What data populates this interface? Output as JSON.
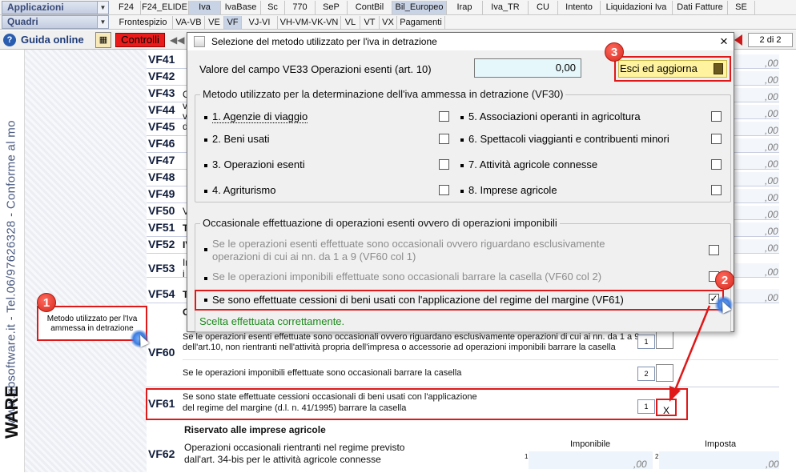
{
  "menu": {
    "applicazioni": "Applicazioni",
    "quadri": "Quadri",
    "tabs_row1": [
      "F24",
      "F24_ELIDE",
      "Iva",
      "IvaBase",
      "Sc",
      "770",
      "SeP",
      "ContBil",
      "Bil_Europeo",
      "Irap",
      "Iva_TR",
      "CU",
      "Intento",
      "Liquidazioni Iva",
      "Dati Fatture",
      "SE"
    ],
    "tabs_row2": [
      "Frontespizio",
      "VA-VB",
      "VE",
      "VF",
      "VJ-VI",
      "VH-VM-VK-VN",
      "VL",
      "VT",
      "VX",
      "Pagamenti"
    ]
  },
  "toolbar": {
    "guida": "Guida online",
    "controlli": "Controlli",
    "page": "2 di 2"
  },
  "side_text": "www.gbsoftware.it - Tel.06/97626328 - Conforme al mo",
  "side_logo": "WARE",
  "form": {
    "rows": [
      "VF41",
      "VF42",
      "VF43",
      "VF44",
      "VF45",
      "VF46",
      "VF47",
      "VF48",
      "VF49",
      "VF50",
      "VF51",
      "VF52",
      "VF53",
      "VF54"
    ],
    "zero": ",00",
    "frag_o": "O",
    "frag_v": "v",
    "frag_d": "d",
    "frag_vo": "Vo",
    "frag_to": "TO",
    "frag_iv": "IV",
    "frag_im": "Im",
    "frag_i": "i",
    "vf60_code": "VF60",
    "vf60_line1": "Se le operazioni esenti effettuate sono occasionali ovvero riguardano esclusivamente operazioni  di cui ai nn. da 1 a 9",
    "vf60_line2": "dell'art.10, non rientranti nell'attività propria dell'impresa o accessorie ad operazioni imponibili barrare la casella",
    "vf60_line3": "Se le operazioni imponibili effettuate sono occasionali barrare la casella",
    "vf60_n1": "1",
    "vf60_n2": "2",
    "vf61_code": "VF61",
    "vf61_line1": "Se sono state effettuate cessioni occasionali di beni usati con l'applicazione",
    "vf61_line2": "del regime del margine (d.l. n. 41/1995) barrare la casella",
    "vf61_n1": "1",
    "vf61_value": "X",
    "riservato": "Riservato alle imprese agricole",
    "vf62_code": "VF62",
    "vf62_line1": "Operazioni occasionali rientranti nel regime previsto",
    "vf62_line2": "dall'art. 34-bis per le attività agricole connesse",
    "imponibile": "Imponibile",
    "imposta": "Imposta",
    "col1": "1",
    "col2": "2",
    "tooltip": "Metodo utilizzato per l'Iva ammessa in detrazione"
  },
  "dialog": {
    "title": "Selezione del metodo utilizzato per l'iva in detrazione",
    "close": "×",
    "ve33_label": "Valore del campo VE33 Operazioni esenti (art. 10)",
    "ve33_value": "0,00",
    "esci_label": "Esci ed aggiorna",
    "group1": "Metodo utilizzato per la determinazione dell'iva ammessa in detrazione (VF30)",
    "opts_left": [
      "1. Agenzie di viaggio",
      "2. Beni usati",
      "3. Operazioni esenti",
      "4. Agriturismo"
    ],
    "opts_right": [
      "5. Associazioni operanti in agricoltura",
      "6. Spettacoli viaggianti e contribuenti minori",
      "7. Attività agricole connesse",
      "8. Imprese agricole"
    ],
    "group2": "Occasionale effettuazione di operazioni esenti ovvero di operazioni imponibili",
    "occ1_line1": "Se le operazioni esenti effettuate sono occasionali ovvero riguardano esclusivamente",
    "occ1_line2": "operazioni di cui ai nn. da 1 a 9 (VF60 col 1)",
    "occ2": "Se le operazioni imponibili effettuate sono occasionali barrare la casella (VF60 col 2)",
    "occ3": "Se sono effettuate cessioni di beni usati con l'applicazione del regime del margine (VF61)",
    "status": "Scelta effettuata correttamente."
  },
  "badges": [
    "1",
    "2",
    "3"
  ],
  "colors": {
    "accent_red": "#e01818",
    "status_green": "#1b8a1b",
    "field_bg": "#e6f7fb"
  }
}
